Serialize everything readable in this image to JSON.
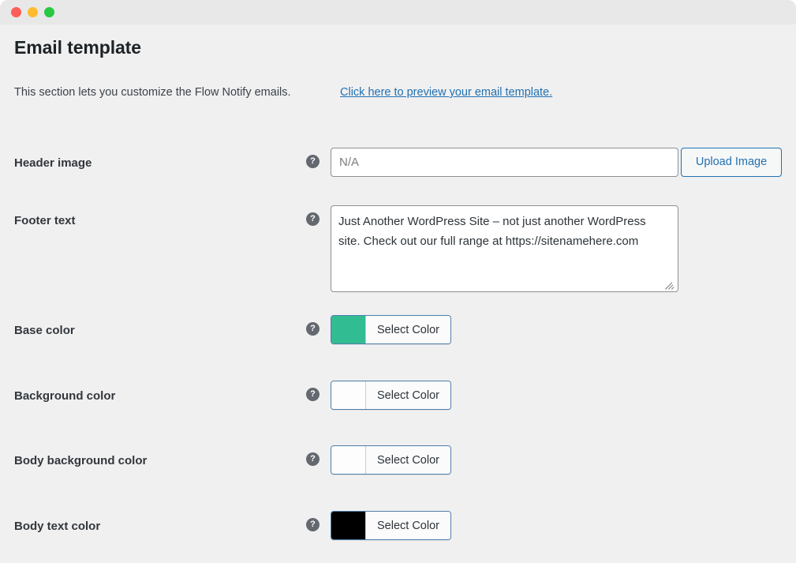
{
  "window": {
    "traffic_lights": [
      "close",
      "minimize",
      "zoom"
    ]
  },
  "page": {
    "title": "Email template",
    "intro_text": "This section lets you customize the Flow Notify emails.",
    "preview_link": "Click here to preview your email template."
  },
  "fields": {
    "header_image": {
      "label": "Header image",
      "help_glyph": "?",
      "value": "",
      "placeholder": "N/A",
      "upload_button": "Upload Image"
    },
    "footer_text": {
      "label": "Footer text",
      "help_glyph": "?",
      "value": "Just Another WordPress Site – not just another WordPress site. Check out our full range at https://sitenamehere.com"
    },
    "base_color": {
      "label": "Base color",
      "help_glyph": "?",
      "button_label": "Select Color",
      "swatch_hex": "#32bc91"
    },
    "background_color": {
      "label": "Background color",
      "help_glyph": "?",
      "button_label": "Select Color",
      "swatch_hex": "#fdfdfd"
    },
    "body_background_color": {
      "label": "Body background color",
      "help_glyph": "?",
      "button_label": "Select Color",
      "swatch_hex": "#fdfdfd"
    },
    "body_text_color": {
      "label": "Body text color",
      "help_glyph": "?",
      "button_label": "Select Color",
      "swatch_hex": "#000000"
    }
  },
  "theme": {
    "titlebar_bg": "#e8e8e8",
    "content_bg": "#f0f0f1",
    "link_blue": "#2271b1",
    "label_color": "#32373c"
  }
}
